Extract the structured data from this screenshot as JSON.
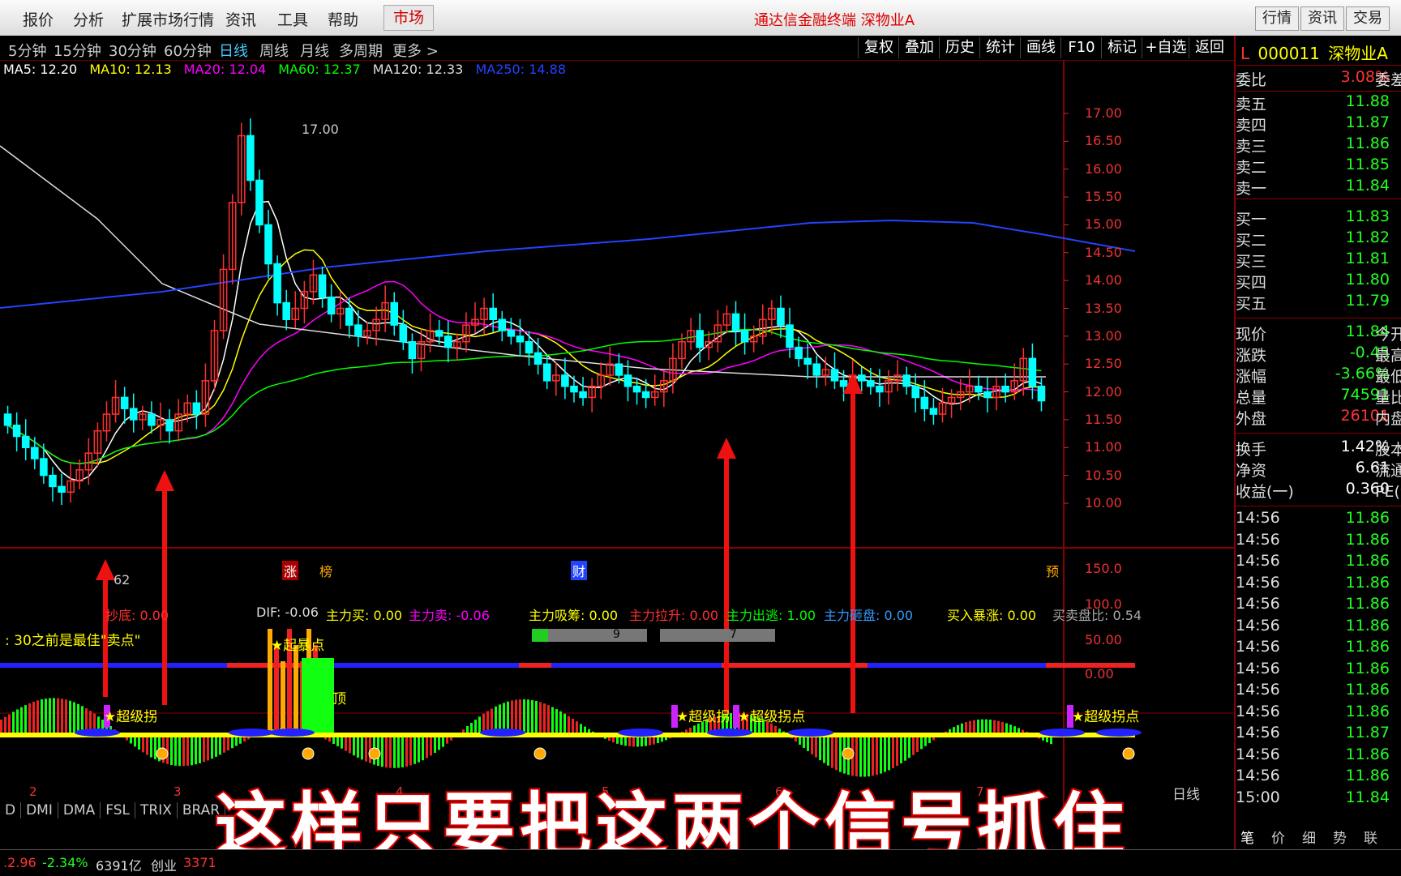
{
  "menubar": {
    "items": [
      "报价",
      "分析",
      "扩展市场行情",
      "资讯",
      "工具",
      "帮助"
    ],
    "market": "市场",
    "app_title": "通达信金融终端  深物业A",
    "right_buttons": [
      "行情",
      "资讯",
      "交易"
    ]
  },
  "toolbar": {
    "periods": [
      "5分钟",
      "15分钟",
      "30分钟",
      "60分钟",
      "日线",
      "周线",
      "月线",
      "多周期",
      "更多 >"
    ],
    "active_period": "日线",
    "buttons": [
      "复权",
      "叠加",
      "历史",
      "统计",
      "画线",
      "F10",
      "标记",
      "+自选",
      "返回"
    ]
  },
  "ma_legend": [
    {
      "label": "MA5: 12.20",
      "color": "#ffffff"
    },
    {
      "label": "MA10: 12.13",
      "color": "#ffff00"
    },
    {
      "label": "MA20: 12.04",
      "color": "#ff00ff"
    },
    {
      "label": "MA60: 12.37",
      "color": "#00ff00"
    },
    {
      "label": "MA120: 12.33",
      "color": "#dddddd"
    },
    {
      "label": "MA250: 14.88",
      "color": "#2244ff"
    }
  ],
  "price_axis": [
    "17.00",
    "16.50",
    "16.00",
    "15.50",
    "15.00",
    "14.50",
    "14.00",
    "13.50",
    "13.00",
    "12.50",
    "12.00",
    "11.50",
    "11.00",
    "10.50",
    "10.00"
  ],
  "chart_annotations": {
    "high": "17.00",
    "low": "62",
    "tags": [
      "涨",
      "榜",
      "财",
      "预"
    ]
  },
  "indicator": {
    "legend": [
      {
        "label": "抄底: 0.00",
        "color": "#ff3030"
      },
      {
        "label": "DIF: -0.06",
        "color": "#dddddd"
      },
      {
        "label": "主力买: 0.00",
        "color": "#ffff00"
      },
      {
        "label": "主力卖: -0.06",
        "color": "#ff00ff"
      },
      {
        "label": "主力吸筹: 0.00",
        "color": "#ffff00"
      },
      {
        "label": "主力拉升: 0.00",
        "color": "#ff3030"
      },
      {
        "label": "主力出逃: 1.00",
        "color": "#00ff00"
      },
      {
        "label": "主力砸盘: 0.00",
        "color": "#3399ff"
      },
      {
        "label": "买入暴涨: 0.00",
        "color": "#ffff00"
      },
      {
        "label": "买卖盘比: 0.54",
        "color": "#aaaaaa"
      }
    ],
    "note": ":  30之前是最佳\"卖点\"",
    "bar1": "9",
    "bar2": "7",
    "axis": [
      "150.0",
      "100.0",
      "50.00",
      "0.00"
    ],
    "signals": [
      "★起暴点",
      "★超级拐",
      "★超级拐",
      "★超级拐点",
      "★超级拐点"
    ],
    "top_label": "顶"
  },
  "bottom_tabs": [
    "D",
    "DMI",
    "DMA",
    "FSL",
    "TRIX",
    "BRAR"
  ],
  "bottom_right_tab": "日线",
  "date_ticks": [
    "2",
    "3",
    "4",
    "5",
    "6",
    "7"
  ],
  "subtitle": "这样只要把这两个信号抓住",
  "status": {
    "items": [
      ".2.96",
      "-2.34%",
      "6391亿",
      "创业",
      "3371"
    ]
  },
  "quote": {
    "code": "000011",
    "name": "深物业A",
    "weibi_label": "委比",
    "weibi": "3.08%",
    "weicha": "委差",
    "asks": [
      {
        "label": "卖五",
        "price": "11.88"
      },
      {
        "label": "卖四",
        "price": "11.87"
      },
      {
        "label": "卖三",
        "price": "11.86"
      },
      {
        "label": "卖二",
        "price": "11.85"
      },
      {
        "label": "卖一",
        "price": "11.84"
      }
    ],
    "bids": [
      {
        "label": "买一",
        "price": "11.83"
      },
      {
        "label": "买二",
        "price": "11.82"
      },
      {
        "label": "买三",
        "price": "11.81"
      },
      {
        "label": "买四",
        "price": "11.80"
      },
      {
        "label": "买五",
        "price": "11.79"
      }
    ],
    "stats": [
      {
        "label": "现价",
        "value": "11.84",
        "extra": "今开"
      },
      {
        "label": "涨跌",
        "value": "-0.45",
        "extra": "最高"
      },
      {
        "label": "涨幅",
        "value": "-3.66%",
        "extra": "最低"
      },
      {
        "label": "总量",
        "value": "74591",
        "extra": "量比"
      },
      {
        "label": "外盘",
        "value": "26101",
        "extra": "内盘"
      }
    ],
    "stats2": [
      {
        "label": "换手",
        "value": "1.42%",
        "extra": "股本"
      },
      {
        "label": "净资",
        "value": "6.61",
        "extra": "流通"
      },
      {
        "label": "收益(一)",
        "value": "0.360",
        "extra": "PE(动"
      }
    ],
    "ticks": [
      {
        "t": "14:56",
        "p": "11.86"
      },
      {
        "t": "14:56",
        "p": "11.86"
      },
      {
        "t": "14:56",
        "p": "11.86"
      },
      {
        "t": "14:56",
        "p": "11.86"
      },
      {
        "t": "14:56",
        "p": "11.86"
      },
      {
        "t": "14:56",
        "p": "11.86"
      },
      {
        "t": "14:56",
        "p": "11.86"
      },
      {
        "t": "14:56",
        "p": "11.86"
      },
      {
        "t": "14:56",
        "p": "11.86"
      },
      {
        "t": "14:56",
        "p": "11.86"
      },
      {
        "t": "14:56",
        "p": "11.87"
      },
      {
        "t": "14:56",
        "p": "11.86"
      },
      {
        "t": "14:56",
        "p": "11.86"
      },
      {
        "t": "15:00",
        "p": "11.84"
      }
    ],
    "bottom_tabs": [
      "笔",
      "价",
      "细",
      "势",
      "联"
    ]
  },
  "colors": {
    "up": "#ff3030",
    "down": "#00ffff",
    "ma250": "#2244ff",
    "frame": "#880000"
  }
}
